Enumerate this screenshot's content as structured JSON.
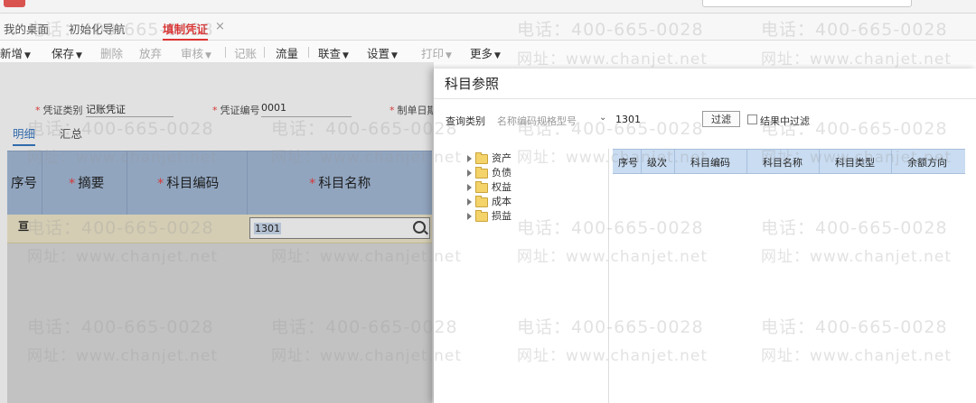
{
  "tabs": [
    {
      "label": "我的桌面"
    },
    {
      "label": "初始化导航"
    },
    {
      "label": "填制凭证",
      "active": true
    }
  ],
  "tab_close_glyph": "×",
  "toolbar": {
    "new": "新增",
    "save": "保存",
    "delete": "删除",
    "discard": "放弃",
    "review": "审核",
    "post": "记账",
    "flow": "流量",
    "linked_query": "联查",
    "settings": "设置",
    "print": "打印",
    "more": "更多"
  },
  "form": {
    "voucher_type_label": "凭证类别",
    "voucher_type_value": "记账凭证",
    "voucher_no_label": "凭证编号",
    "voucher_no_value": "0001",
    "date_label": "制单日期"
  },
  "subtabs": {
    "detail": "明细",
    "summary": "汇总"
  },
  "grid": {
    "columns": [
      "序号",
      "摘要",
      "科目编码",
      "科目名称"
    ],
    "row_icon": "亘",
    "cell_value": "1301"
  },
  "dialog": {
    "title": "科目参照",
    "query_label": "查询类别",
    "query_hint": "名称编码规格型号",
    "query_value": "1301",
    "filter_button": "过滤",
    "filter_in_result": "结果中过滤",
    "tree_nodes": [
      "资产",
      "负债",
      "权益",
      "成本",
      "损益"
    ],
    "table_columns": [
      "序号",
      "级次",
      "科目编码",
      "科目名称",
      "科目类型",
      "余额方向"
    ]
  },
  "watermark": {
    "phone": "电话：400-665-0028",
    "url": "网址：www.chanjet.net"
  },
  "colors": {
    "active_tab": "#dd3333",
    "grid_header": "#9eb6d6",
    "selected_row": "#efe7c8",
    "dialog_table_header": "#c9dcf1"
  },
  "icons": [
    "search-icon",
    "folder-icon",
    "expand-arrow-icon",
    "close-icon",
    "caret-down-icon"
  ]
}
